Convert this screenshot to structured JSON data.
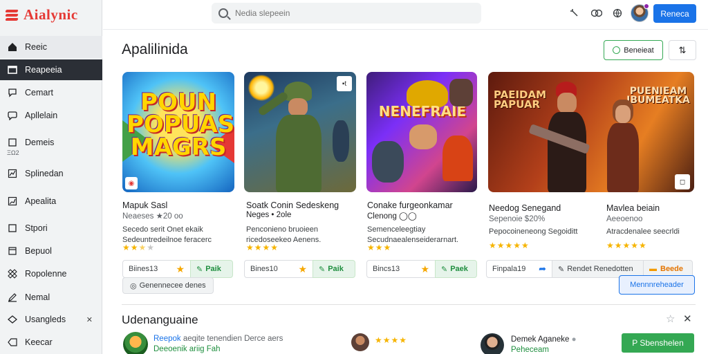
{
  "app": {
    "logo_text": "Aialynic"
  },
  "header": {
    "search_placeholder": "Nedia slepeein",
    "primary_button": "Reneca"
  },
  "sidebar": {
    "items": [
      {
        "label": "Reeic",
        "icon": "home-icon"
      },
      {
        "label": "Reapeeia",
        "icon": "window-icon"
      },
      {
        "label": "Cemart",
        "icon": "chat-icon"
      },
      {
        "label": "Apllelain",
        "icon": "chat-bubble-icon"
      },
      {
        "label": "Demeis",
        "icon": "square-icon"
      },
      {
        "label": "Splinedan",
        "icon": "chart-icon"
      },
      {
        "label": "Apealita",
        "icon": "graph-icon"
      },
      {
        "label": "Stpori",
        "icon": "square-icon"
      },
      {
        "label": "Bepuol",
        "icon": "bookmark-icon"
      },
      {
        "label": "Ropolenne",
        "icon": "grid-icon"
      },
      {
        "label": "Nemal",
        "icon": "pen-icon"
      },
      {
        "label": "Usangleds",
        "icon": "shield-icon"
      },
      {
        "label": "Keecar",
        "icon": "tag-icon"
      }
    ],
    "small_label": "ΞΩ2"
  },
  "main": {
    "title": "Apalilinida",
    "filter_button": "Beneieat",
    "cards": [
      {
        "art_text": "POUN\nPOPUAS\nMAGRS",
        "title": "Mapuk Sasl",
        "subtitle": "Neaeses ★20 oo",
        "desc": [
          "Secedo serit Onet ekaik",
          "Sedeuntredeilnoe feracerc"
        ],
        "rating": 2.5,
        "left_label": "Biines13",
        "right_label": "Paik"
      },
      {
        "art_text": "",
        "title": "Soatk Conin Sedeskeng",
        "subtitle": "Neges • 2ole",
        "desc": [
          "Penconieno bruoieen",
          "ricedoseekeo Aenens."
        ],
        "rating": 4,
        "left_label": "Bines10",
        "right_label": "Paik"
      },
      {
        "art_text": "NENEFRAIE",
        "title": "Conake furgeonkamar",
        "subtitle": "Clenong ◯◯",
        "desc": [
          "Semenceleegtiay",
          "Secudnaealenseiderarnart."
        ],
        "rating": 3,
        "left_label": "Bincs13",
        "right_label": "Paek"
      },
      {
        "art_text_left": "PAEIDAM\nPAPUAR",
        "art_text_right": "PUENIEAM\nIBUMEATKA",
        "title": "Needog Senegand",
        "title_right": "Mavlea beiain",
        "subtitle": "Sepenoie $20%",
        "subtitle_right": "Aeeoenoo",
        "desc": [
          "Pepocoineneong Segoiditt"
        ],
        "desc_right": [
          "Atracdenalee seecrldi"
        ],
        "rating": 5,
        "rating_right": 5,
        "left_label": "Finpala19",
        "right_label": "Rendet Renedotten",
        "right_label_2": "Beede"
      }
    ],
    "chip_label": "Genennecee denes",
    "more_button": "Mennnreheader",
    "section_title": "Udenanguaine",
    "rows": [
      {
        "name": "Reepok",
        "extra": "aeqite tenendien Derce aers",
        "sub": "Deeoenik ariig Fah"
      },
      {
        "name": "",
        "rating": 4
      },
      {
        "name": "Demek Aganeke",
        "sub": "Peheceam"
      }
    ],
    "action_button": "P Sbenshelen"
  }
}
